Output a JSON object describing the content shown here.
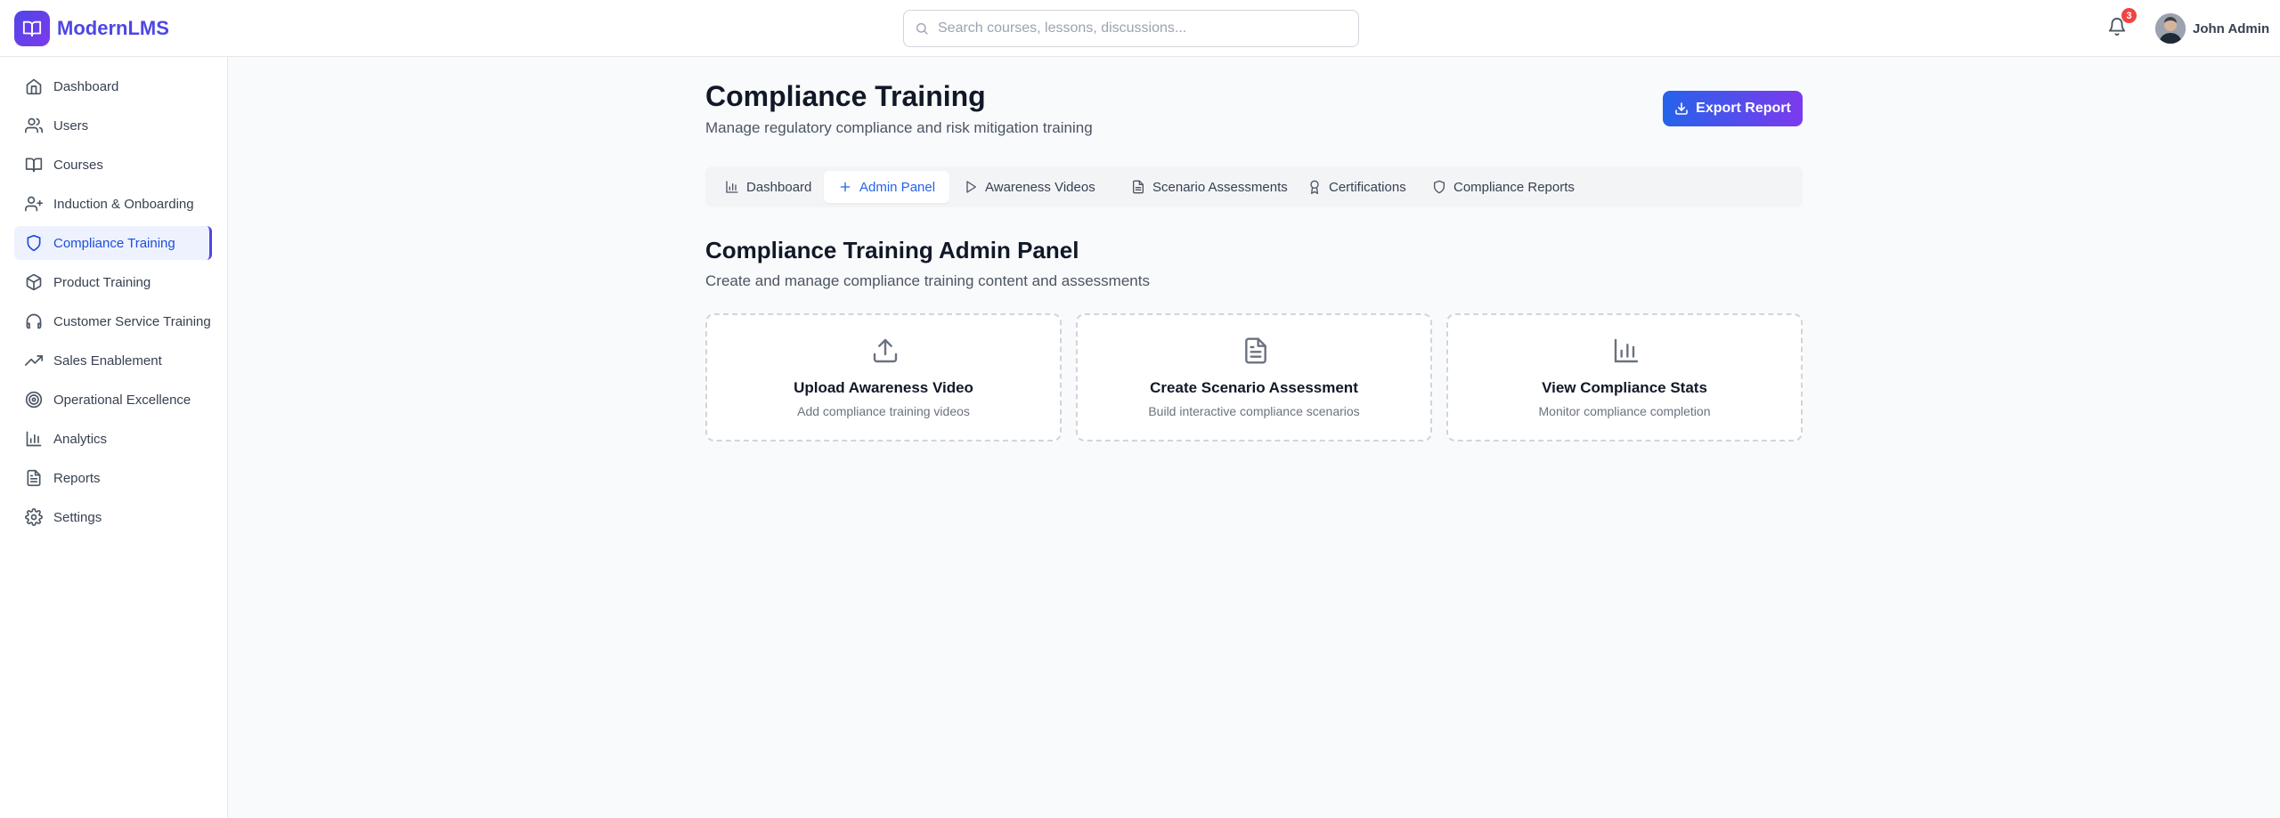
{
  "app": {
    "name": "ModernLMS"
  },
  "search": {
    "placeholder": "Search courses, lessons, discussions..."
  },
  "notifications": {
    "count": "3"
  },
  "user": {
    "name": "John Admin"
  },
  "sidebar": {
    "items": [
      {
        "label": "Dashboard",
        "icon": "home-icon"
      },
      {
        "label": "Users",
        "icon": "users-icon"
      },
      {
        "label": "Courses",
        "icon": "book-icon"
      },
      {
        "label": "Induction & Onboarding",
        "icon": "user-plus-icon"
      },
      {
        "label": "Compliance Training",
        "icon": "shield-icon",
        "active": true
      },
      {
        "label": "Product Training",
        "icon": "package-icon"
      },
      {
        "label": "Customer Service Training",
        "icon": "headphones-icon"
      },
      {
        "label": "Sales Enablement",
        "icon": "trending-up-icon"
      },
      {
        "label": "Operational Excellence",
        "icon": "target-icon"
      },
      {
        "label": "Analytics",
        "icon": "bar-chart-icon"
      },
      {
        "label": "Reports",
        "icon": "file-text-icon"
      },
      {
        "label": "Settings",
        "icon": "gear-icon"
      }
    ]
  },
  "page": {
    "title": "Compliance Training",
    "subtitle": "Manage regulatory compliance and risk mitigation training",
    "export_label": "Export Report"
  },
  "tabs": [
    {
      "label": "Dashboard",
      "icon": "bar-chart-icon"
    },
    {
      "label": "Admin Panel",
      "icon": "plus-icon",
      "active": true
    },
    {
      "label": "Awareness Videos",
      "icon": "play-icon"
    },
    {
      "label": "Scenario Assessments",
      "icon": "file-text-icon"
    },
    {
      "label": "Certifications",
      "icon": "award-icon"
    },
    {
      "label": "Compliance Reports",
      "icon": "shield-icon"
    }
  ],
  "admin": {
    "title": "Compliance Training Admin Panel",
    "subtitle": "Create and manage compliance training content and assessments",
    "cards": [
      {
        "title": "Upload Awareness Video",
        "description": "Add compliance training videos",
        "icon": "upload-icon"
      },
      {
        "title": "Create Scenario Assessment",
        "description": "Build interactive compliance scenarios",
        "icon": "file-text-icon"
      },
      {
        "title": "View Compliance Stats",
        "description": "Monitor compliance completion",
        "icon": "bar-chart-icon"
      }
    ]
  },
  "colors": {
    "brand": "#4f46e5",
    "accent": "#2563eb",
    "badge": "#ef4444",
    "active_bg": "#eef2ff"
  }
}
